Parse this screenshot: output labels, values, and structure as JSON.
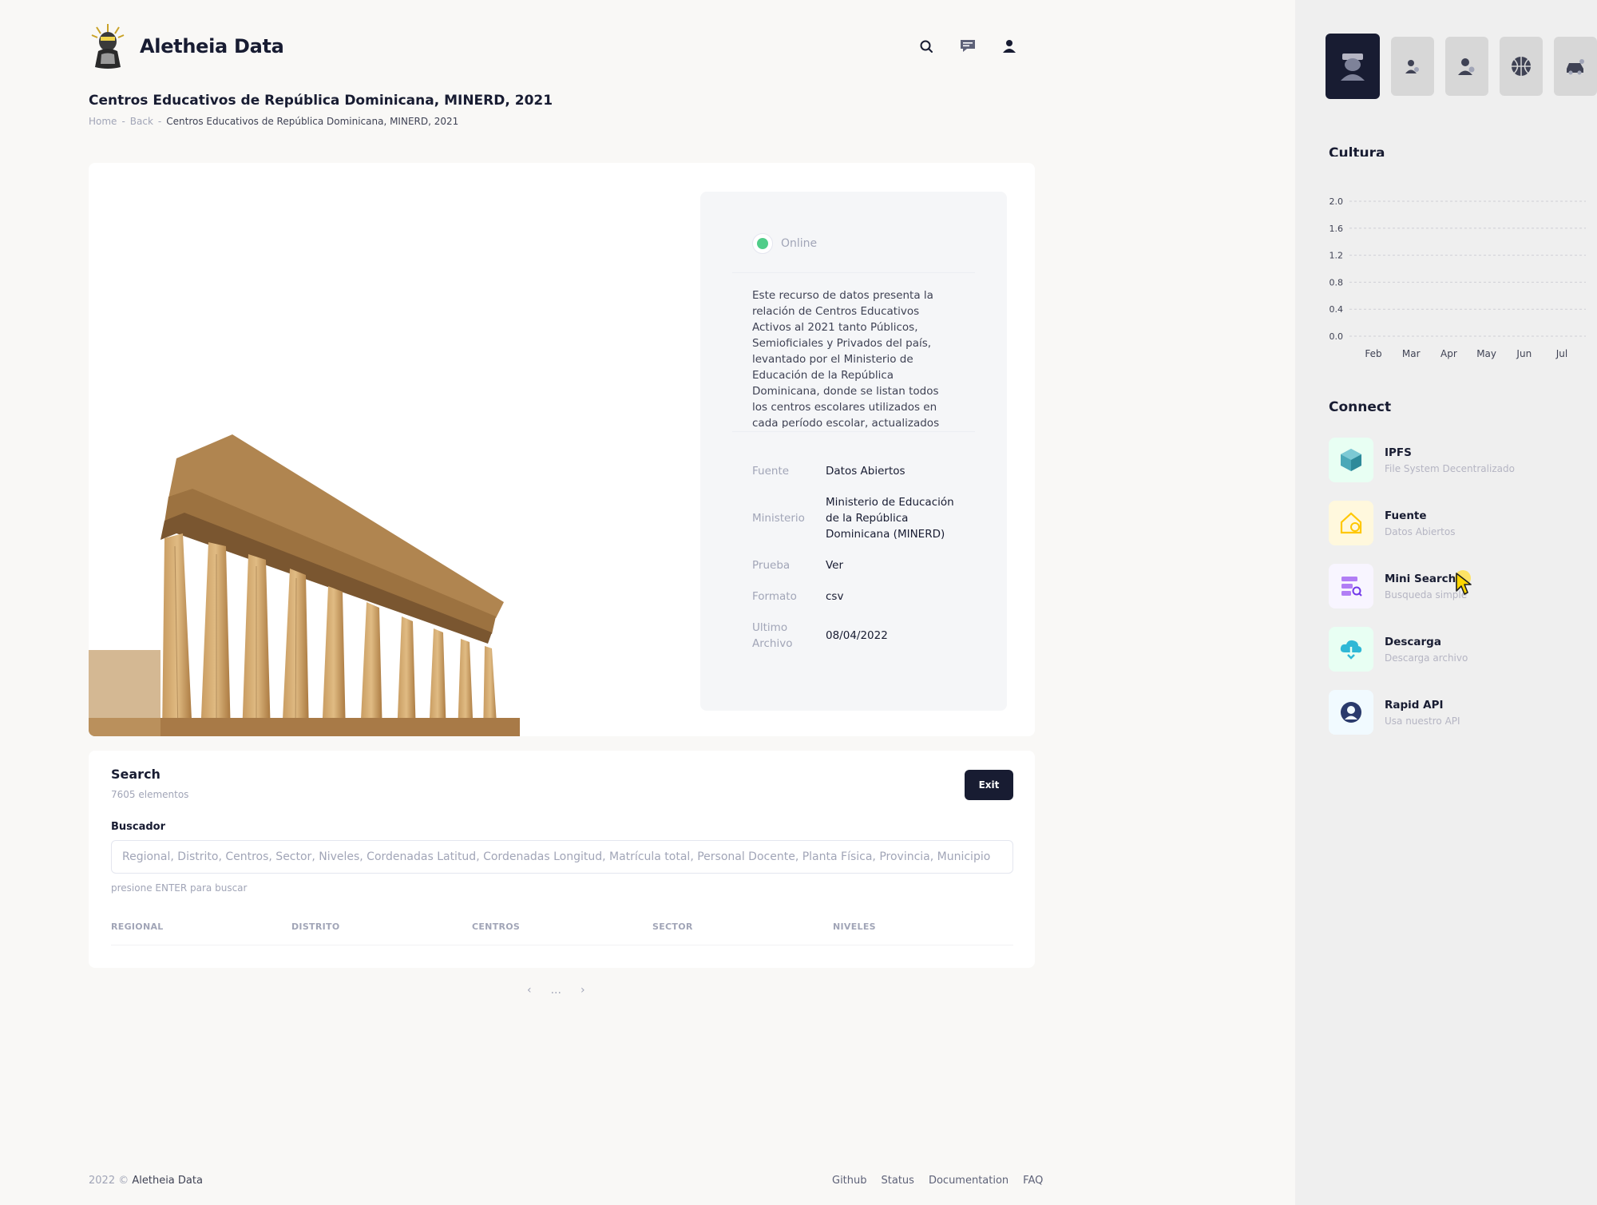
{
  "header": {
    "brand": "Aletheia Data",
    "icons": [
      "search-icon",
      "message-icon",
      "user-icon"
    ]
  },
  "page": {
    "title": "Centros Educativos de República Dominicana, MINERD, 2021",
    "breadcrumb": {
      "home": "Home",
      "back": "Back",
      "current": "Centros Educativos de República Dominicana, MINERD, 2021"
    }
  },
  "info": {
    "status": "Online",
    "status_color": "#50cd89",
    "description": "Este recurso de datos presenta la relación de Centros Educativos Activos al 2021 tanto Públicos, Semioficiales y Privados del país, levantado por el Ministerio de Educación de la República Dominicana, donde se listan todos los centros escolares utilizados en cada período escolar, actualizados",
    "rows": [
      {
        "key": "Fuente",
        "value": "Datos Abiertos"
      },
      {
        "key": "Ministerio",
        "value": "Ministerio de Educación de la República Dominicana (MINERD)"
      },
      {
        "key": "Prueba",
        "value": "Ver"
      },
      {
        "key": "Formato",
        "value": "csv"
      },
      {
        "key": "Ultimo Archivo",
        "value": "08/04/2022"
      }
    ]
  },
  "search": {
    "title": "Search",
    "count": "7605 elementos",
    "exit_label": "Exit",
    "field_label": "Buscador",
    "placeholder": "Regional, Distrito, Centros, Sector, Niveles, Cordenadas Latitud, Cordenadas Longitud, Matrícula total, Personal Docente, Planta Física, Provincia, Municipio",
    "hint": "presione ENTER para buscar",
    "columns": [
      "REGIONAL",
      "DISTRITO",
      "CENTROS",
      "SECTOR",
      "NIVELES"
    ]
  },
  "pager": {
    "prev": "‹",
    "dots": "...",
    "next": "›"
  },
  "footer": {
    "year": "2022 ©",
    "brand": "Aletheia Data",
    "links": [
      "Github",
      "Status",
      "Documentation",
      "FAQ"
    ]
  },
  "aside": {
    "chart_title": "Cultura",
    "connect_title": "Connect",
    "connect_items": [
      {
        "name": "IPFS",
        "sub": "File System Decentralizado",
        "icon": "cube-icon",
        "bg": "#e8fff3",
        "color": "#2e8a9a"
      },
      {
        "name": "Fuente",
        "sub": "Datos Abiertos",
        "icon": "home-icon",
        "bg": "#fff8dd",
        "color": "#ffc700"
      },
      {
        "name": "Mini Search",
        "sub": "Busqueda simple",
        "icon": "search-list-icon",
        "bg": "#f8f5ff",
        "color": "#7239ea"
      },
      {
        "name": "Descarga",
        "sub": "Descarga archivo",
        "icon": "cloud-download-icon",
        "bg": "#e8fff3",
        "color": "#2fb8d6"
      },
      {
        "name": "Rapid API",
        "sub": "Usa nuestro API",
        "icon": "api-icon",
        "bg": "#f1faff",
        "color": "#2a3a6c"
      }
    ]
  },
  "chart_data": {
    "type": "line",
    "title": "Cultura",
    "categories": [
      "Feb",
      "Mar",
      "Apr",
      "May",
      "Jun",
      "Jul"
    ],
    "series": [],
    "yticks": [
      "2.0",
      "1.6",
      "1.2",
      "0.8",
      "0.4",
      "0.0"
    ],
    "ylim": [
      0,
      2.0
    ],
    "grid": true
  }
}
